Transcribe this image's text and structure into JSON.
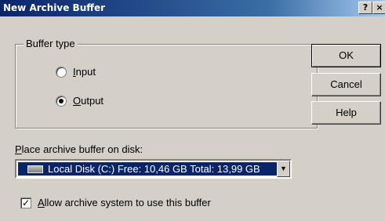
{
  "window": {
    "title": "New Archive Buffer",
    "help_glyph": "?",
    "close_glyph": "×"
  },
  "buffer_type": {
    "label": "Buffer type",
    "options": [
      {
        "mnemonic": "I",
        "rest": "nput",
        "selected": false
      },
      {
        "mnemonic": "O",
        "rest": "utput",
        "selected": true
      }
    ]
  },
  "buttons": {
    "ok": "OK",
    "cancel": "Cancel",
    "help": "Help"
  },
  "disk": {
    "label_mnemonic": "P",
    "label_rest": "lace archive buffer on disk:",
    "selected": "Local Disk (C:) Free:  10,46 GB Total:  13,99 GB",
    "arrow": "▼"
  },
  "allow": {
    "checked": true,
    "check_glyph": "✓",
    "mnemonic": "A",
    "rest": "llow archive system to use this buffer"
  },
  "colors": {
    "face": "#d4d0c8",
    "title_start": "#0a246a",
    "selection": "#0a246a"
  },
  "icons": {
    "disk": "hard-drive-icon",
    "radio": "radio-button",
    "check": "checkbox"
  }
}
